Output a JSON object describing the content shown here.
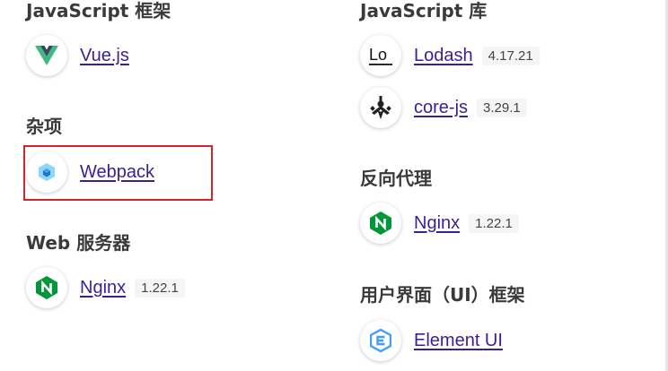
{
  "left": {
    "js_frameworks": {
      "heading": "JavaScript 框架",
      "items": [
        {
          "name": "Vue.js",
          "icon": "vue-icon"
        }
      ]
    },
    "misc": {
      "heading": "杂项",
      "items": [
        {
          "name": "Webpack",
          "icon": "webpack-icon"
        }
      ]
    },
    "web_servers": {
      "heading": "Web 服务器",
      "items": [
        {
          "name": "Nginx",
          "version": "1.22.1",
          "icon": "nginx-icon"
        }
      ]
    }
  },
  "right": {
    "js_libraries": {
      "heading": "JavaScript 库",
      "items": [
        {
          "name": "Lodash",
          "version": "4.17.21",
          "icon": "lodash-icon"
        },
        {
          "name": "core-js",
          "version": "3.29.1",
          "icon": "core-js-icon"
        }
      ]
    },
    "reverse_proxies": {
      "heading": "反向代理",
      "items": [
        {
          "name": "Nginx",
          "version": "1.22.1",
          "icon": "nginx-icon"
        }
      ]
    },
    "ui_frameworks": {
      "heading": "用户界面（UI）框架",
      "items": [
        {
          "name": "Element UI",
          "icon": "element-ui-icon"
        }
      ]
    }
  },
  "colors": {
    "link": "#3b1e96",
    "highlight_border": "#d3262b",
    "vue_green": "#41b883",
    "vue_dark": "#34495e",
    "nginx_green": "#009639",
    "webpack_blue": "#8ed6fb",
    "element_blue": "#409eff"
  }
}
